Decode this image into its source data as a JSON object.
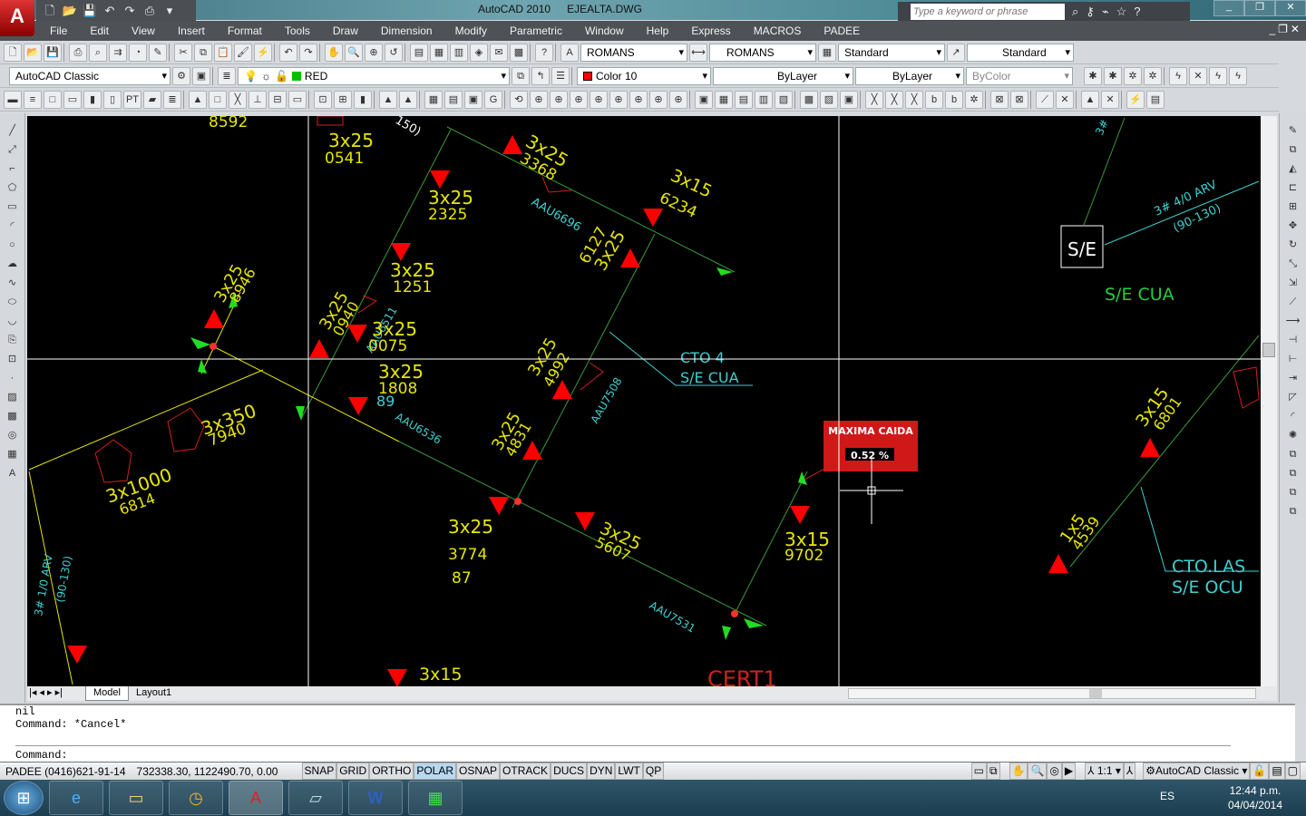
{
  "app": {
    "title": "AutoCAD 2010",
    "file": "EJEALTA.DWG",
    "logo": "A"
  },
  "search": {
    "placeholder": "Type a keyword or phrase"
  },
  "menu": [
    "File",
    "Edit",
    "View",
    "Insert",
    "Format",
    "Tools",
    "Draw",
    "Dimension",
    "Modify",
    "Parametric",
    "Window",
    "Help",
    "Express",
    "MACROS",
    "PADEE"
  ],
  "toolbar": {
    "text_style": "ROMANS",
    "dim_style": "ROMANS",
    "table_style": "Standard",
    "mleader_style": "Standard",
    "workspace": "AutoCAD Classic",
    "layer": "RED",
    "layer_color": "#00c000",
    "color": "Color 10",
    "color_swatch": "#ff0000",
    "linetype": "ByLayer",
    "lineweight": "ByLayer",
    "plotstyle": "ByColor"
  },
  "drawing": {
    "labels": [
      "8592",
      "3x25",
      "0541",
      "150)",
      "3x25",
      "3368",
      "3x15",
      "6234",
      "AAU6696",
      "3x25",
      "2325",
      "3x25",
      "6127",
      "3x25",
      "1251",
      "3x25",
      "8946",
      "3x25",
      "0940",
      "AAU6511",
      "3x25",
      "0075",
      "CTO 4",
      "S/E CUA",
      "3x25",
      "1808",
      "89",
      "3x25",
      "4992",
      "AAU7508",
      "AAU6536",
      "3x350",
      "7940",
      "3x25",
      "4831",
      "3x1000",
      "6814",
      "3x25",
      "3774",
      "87",
      "3x25",
      "5607",
      "3x15",
      "9702",
      "AAU7531",
      "3x15",
      "CERT1",
      "3# 1/0 ARV",
      "(90-130)",
      "S/E",
      "S/E  CUA",
      "3# 4/0 ARV",
      "(90-130)",
      "3#",
      "3x15",
      "6801",
      "1x5",
      "4539",
      "CTO.LAS",
      "S/E  OCU"
    ],
    "callout": {
      "title": "MAXIMA  CAIDA",
      "value": "0.52  %"
    }
  },
  "tabs": [
    "Model",
    "Layout1"
  ],
  "command": {
    "history": [
      "nil",
      "Command: *Cancel*"
    ],
    "prompt": "Command:"
  },
  "status": {
    "left_text": "PADEE (0416)621-91-14",
    "coords": "732338.30, 1122490.70, 0.00",
    "toggles": [
      "SNAP",
      "GRID",
      "ORTHO",
      "POLAR",
      "OSNAP",
      "OTRACK",
      "DUCS",
      "DYN",
      "LWT",
      "QP"
    ],
    "active_toggle": "POLAR",
    "scale": "1:1",
    "workspace": "AutoCAD Classic"
  },
  "taskbar": {
    "lang": "ES",
    "time": "12:44 p.m.",
    "date": "04/04/2014"
  }
}
